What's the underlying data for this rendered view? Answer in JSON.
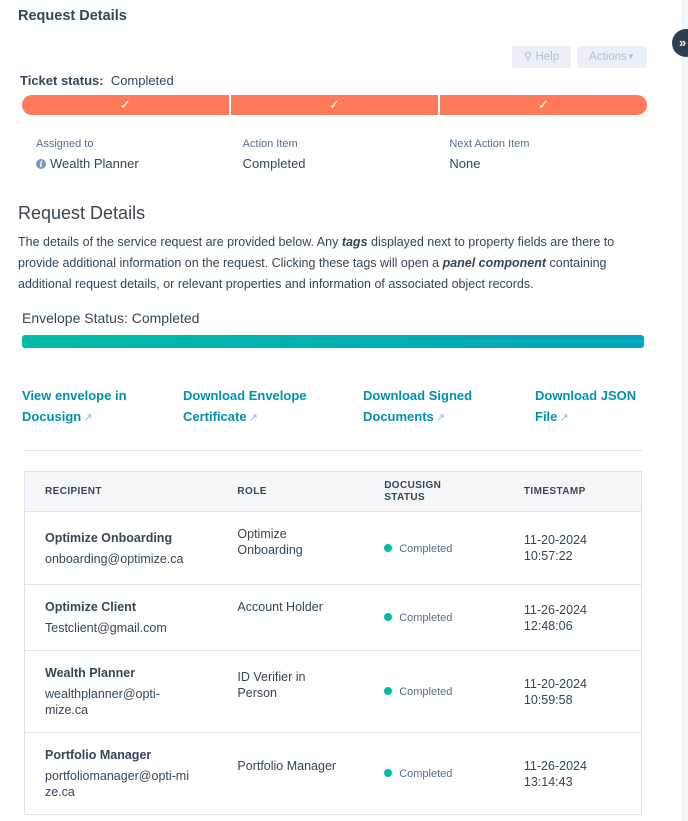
{
  "header": {
    "title": "Request Details",
    "help_label": "Help",
    "actions_label": "Actions",
    "collapse_icon": "»"
  },
  "ticket": {
    "status_label": "Ticket status:",
    "status_value": "Completed",
    "steps": [
      {
        "icon": "✓",
        "state": "complete"
      },
      {
        "icon": "✓",
        "state": "complete"
      },
      {
        "icon": "✓",
        "state": "complete"
      }
    ],
    "accent_color": "#ff7a59"
  },
  "properties": [
    {
      "label": "Assigned to",
      "value": "Wealth Planner",
      "icon": "info-icon"
    },
    {
      "label": "Action Item",
      "value": "Completed"
    },
    {
      "label": "Next Action Item",
      "value": "None"
    }
  ],
  "details": {
    "heading": "Request Details",
    "desc_1": "The details of the service request are provided below. Any ",
    "desc_tags": "tags",
    "desc_2": " displayed next to property fields are there to provide additional information on the request. Clicking these tags will open a ",
    "desc_panel": "panel component",
    "desc_3": " containing additional request details, or relevant properties and information of associated object records."
  },
  "envelope": {
    "status_text": "Envelope Status: Completed",
    "progress_percent": 100
  },
  "links": [
    {
      "line1": "View envelope in",
      "line2": "Docusign"
    },
    {
      "line1": "Download Envelope",
      "line2": "Certificate"
    },
    {
      "line1": "Download Signed",
      "line2": "Documents"
    },
    {
      "line1": "Download JSON",
      "line2": "File"
    }
  ],
  "table": {
    "headers": [
      "RECIPIENT",
      "ROLE",
      "DOCUSIGN STATUS",
      "TIMESTAMP"
    ],
    "rows": [
      {
        "name": "Optimize Onboarding",
        "email": "onboarding@optimize.ca",
        "role": "Optimize Onboarding",
        "status": "Completed",
        "date": "11-20-2024",
        "time": "10:57:22"
      },
      {
        "name": "Optimize Client",
        "email": "Testclient@gmail.com",
        "role": "Account Holder",
        "status": "Completed",
        "date": "11-26-2024",
        "time": "12:48:06"
      },
      {
        "name": "Wealth Planner",
        "email": "wealthplanner@opti-mize.ca",
        "role": "ID Verifier in Person",
        "status": "Completed",
        "date": "11-20-2024",
        "time": "10:59:58"
      },
      {
        "name": "Portfolio Manager",
        "email": "portfoliomanager@opti-mize.ca",
        "role": "Portfolio Manager",
        "status": "Completed",
        "date": "11-26-2024",
        "time": "13:14:43"
      }
    ]
  }
}
